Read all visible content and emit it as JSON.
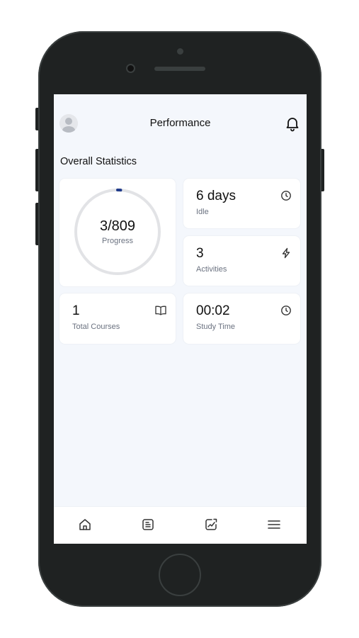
{
  "header": {
    "title": "Performance",
    "avatar_icon": "avatar-icon",
    "notification_icon": "bell-icon"
  },
  "overall": {
    "section_title": "Overall Statistics",
    "progress": {
      "value": "3/809",
      "label": "Progress",
      "fraction": 0.0037
    },
    "idle": {
      "value": "6 days",
      "label": "Idle",
      "icon": "clock-icon"
    },
    "activities": {
      "value": "3",
      "label": "Activities",
      "icon": "lightning-icon"
    },
    "courses": {
      "value": "1",
      "label": "Total Courses",
      "icon": "book-icon"
    },
    "study_time": {
      "value": "00:02",
      "label": "Study Time",
      "icon": "clock-icon"
    }
  },
  "bottom_nav": {
    "items": [
      {
        "name": "home",
        "icon": "home-icon"
      },
      {
        "name": "notes",
        "icon": "document-icon"
      },
      {
        "name": "performance",
        "icon": "chart-icon",
        "active": true
      },
      {
        "name": "menu",
        "icon": "hamburger-icon"
      }
    ]
  },
  "colors": {
    "screen_bg": "#f4f7fc",
    "card_bg": "#ffffff",
    "ring_track": "#e2e3e6",
    "ring_progress": "#1f3a8a",
    "phone_body": "#1f2222"
  }
}
